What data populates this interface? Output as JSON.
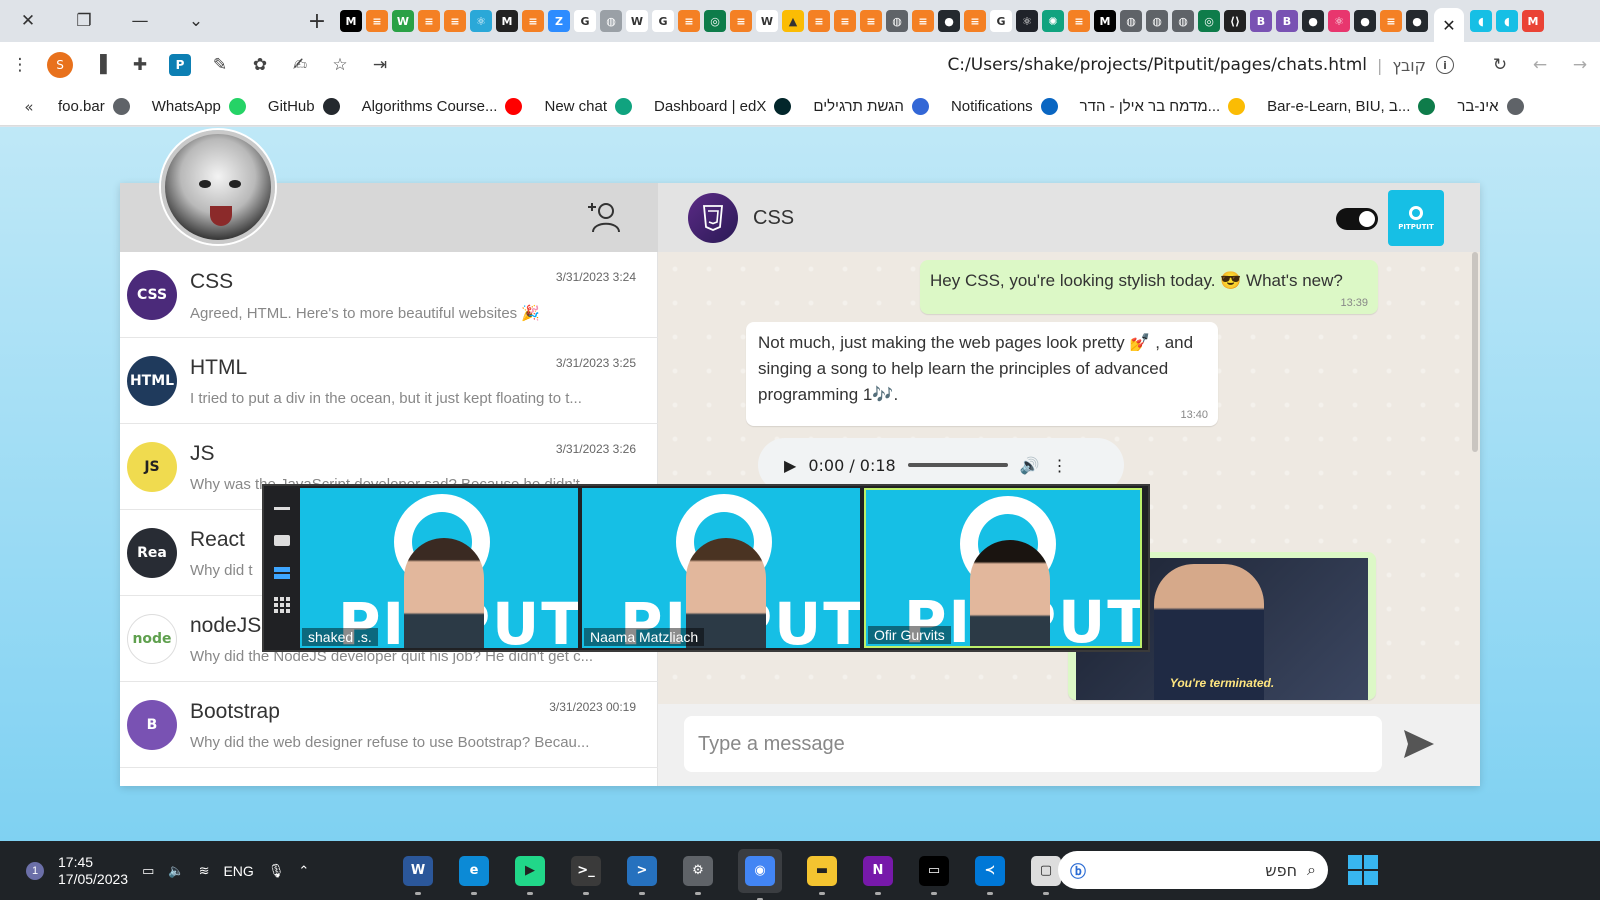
{
  "browser": {
    "window_controls": [
      "✕",
      "❐",
      "—",
      "⌄"
    ],
    "favicon_tabs": [
      {
        "icon": "medium-icon",
        "color": "#000000",
        "glyph": "M"
      },
      {
        "icon": "stackoverflow-icon",
        "color": "#f48024",
        "glyph": "≡"
      },
      {
        "icon": "wix-icon",
        "color": "#2aa146",
        "glyph": "W"
      },
      {
        "icon": "stackoverflow-icon",
        "color": "#f48024",
        "glyph": "≡"
      },
      {
        "icon": "stackoverflow-icon",
        "color": "#f48024",
        "glyph": "≡"
      },
      {
        "icon": "react-icon",
        "color": "#2aa8d8",
        "glyph": "⚛"
      },
      {
        "icon": "medium-icon",
        "color": "#222222",
        "glyph": "M"
      },
      {
        "icon": "stackoverflow-icon",
        "color": "#f48024",
        "glyph": "≡"
      },
      {
        "icon": "zoom-icon",
        "color": "#2d8cff",
        "glyph": "Z"
      },
      {
        "icon": "google-icon",
        "color": "#ffffff",
        "glyph": "G"
      },
      {
        "icon": "globe-icon",
        "color": "#9aa0a6",
        "glyph": "◍"
      },
      {
        "icon": "wikipedia-icon",
        "color": "#ffffff",
        "glyph": "W"
      },
      {
        "icon": "google-icon",
        "color": "#ffffff",
        "glyph": "G"
      },
      {
        "icon": "stackoverflow-icon",
        "color": "#f48024",
        "glyph": "≡"
      },
      {
        "icon": "moodle-icon",
        "color": "#0e7c4a",
        "glyph": "◎"
      },
      {
        "icon": "stackoverflow-icon",
        "color": "#f48024",
        "glyph": "≡"
      },
      {
        "icon": "wikipedia-icon",
        "color": "#ffffff",
        "glyph": "W"
      },
      {
        "icon": "drive-icon",
        "color": "#fbbc04",
        "glyph": "▲"
      },
      {
        "icon": "stackoverflow-icon",
        "color": "#f48024",
        "glyph": "≡"
      },
      {
        "icon": "stackoverflow-icon",
        "color": "#f48024",
        "glyph": "≡"
      },
      {
        "icon": "stackoverflow-icon",
        "color": "#f48024",
        "glyph": "≡"
      },
      {
        "icon": "globe-icon",
        "color": "#5f6368",
        "glyph": "◍"
      },
      {
        "icon": "stackoverflow-icon",
        "color": "#f48024",
        "glyph": "≡"
      },
      {
        "icon": "github-icon",
        "color": "#24292e",
        "glyph": "●"
      },
      {
        "icon": "stackoverflow-icon",
        "color": "#f48024",
        "glyph": "≡"
      },
      {
        "icon": "google-icon",
        "color": "#ffffff",
        "glyph": "G"
      },
      {
        "icon": "react-icon",
        "color": "#20232a",
        "glyph": "⚛"
      },
      {
        "icon": "chatgpt-icon",
        "color": "#10a37f",
        "glyph": "✺"
      },
      {
        "icon": "stackoverflow-icon",
        "color": "#f48024",
        "glyph": "≡"
      },
      {
        "icon": "medium-icon",
        "color": "#000000",
        "glyph": "M"
      },
      {
        "icon": "globe-icon",
        "color": "#5f6368",
        "glyph": "◍"
      },
      {
        "icon": "globe-icon",
        "color": "#5f6368",
        "glyph": "◍"
      },
      {
        "icon": "globe-icon",
        "color": "#5f6368",
        "glyph": "◍"
      },
      {
        "icon": "moodle-icon",
        "color": "#0e7c4a",
        "glyph": "◎"
      },
      {
        "icon": "n8n-icon",
        "color": "#222222",
        "glyph": "⟨⟩"
      },
      {
        "icon": "bootstrap-icon",
        "color": "#7952b3",
        "glyph": "B"
      },
      {
        "icon": "bootstrap-icon",
        "color": "#7952b3",
        "glyph": "B"
      },
      {
        "icon": "github-icon",
        "color": "#24292e",
        "glyph": "●"
      },
      {
        "icon": "react-icon",
        "color": "#e8366e",
        "glyph": "⚛"
      },
      {
        "icon": "github-icon",
        "color": "#24292e",
        "glyph": "●"
      },
      {
        "icon": "stackoverflow-icon",
        "color": "#f48024",
        "glyph": "≡"
      },
      {
        "icon": "github-icon",
        "color": "#24292e",
        "glyph": "●"
      }
    ],
    "active_tab_close": "✕",
    "trailing_tabs": [
      {
        "icon": "chat-icon",
        "color": "#16bfe5",
        "glyph": "◖"
      },
      {
        "icon": "chat-icon",
        "color": "#16bfe5",
        "glyph": "◖"
      },
      {
        "icon": "gmail-icon",
        "color": "#ea4335",
        "glyph": "M"
      }
    ],
    "profile_letter": "S",
    "url": "C:/Users/shake/projects/Pitputit/pages/chats.html",
    "url_scheme_label": "קובץ",
    "bookmarks": [
      {
        "label": "foo.bar",
        "icon": "globe-icon",
        "color": "#5f6368"
      },
      {
        "label": "WhatsApp",
        "icon": "whatsapp-icon",
        "color": "#25d366"
      },
      {
        "label": "GitHub",
        "icon": "github-icon",
        "color": "#24292e"
      },
      {
        "label": "Algorithms Course...",
        "icon": "youtube-icon",
        "color": "#ff0000"
      },
      {
        "label": "New chat",
        "icon": "chatgpt-icon",
        "color": "#10a37f"
      },
      {
        "label": "Dashboard | edX",
        "icon": "edx-icon",
        "color": "#02262b"
      },
      {
        "label": "הגשת תרגילים",
        "icon": "submit-icon",
        "color": "#3367d6"
      },
      {
        "label": "Notifications",
        "icon": "linkedin-icon",
        "color": "#0a66c2"
      },
      {
        "label": "מדמח בר אילן - הדר...",
        "icon": "drive-icon",
        "color": "#fbbc04"
      },
      {
        "label": "Bar-e-Learn, BIU, ב...",
        "icon": "moodle-icon",
        "color": "#0e7c4a"
      },
      {
        "label": "אינ-בר",
        "icon": "globe-icon",
        "color": "#5f6368"
      }
    ]
  },
  "app": {
    "current_user_avatar": "user-avatar",
    "chats": [
      {
        "name": "CSS",
        "time": "3/31/2023 3:24",
        "preview": "Agreed, HTML. Here's to more beautiful websites 🎉",
        "avatar_color": "#4b2a7a",
        "avatar_text": "CSS"
      },
      {
        "name": "HTML",
        "time": "3/31/2023 3:25",
        "preview": "I tried to put a div in the ocean, but it just kept floating to t...",
        "avatar_color": "#1f3a5c",
        "avatar_text": "HTML"
      },
      {
        "name": "JS",
        "time": "3/31/2023 3:26",
        "preview": "Why was the JavaScript developer sad? Because he didn't",
        "avatar_color": "#f0db4f",
        "avatar_text": "JS"
      },
      {
        "name": "React",
        "time": "",
        "preview": "Why did t",
        "avatar_color": "#282c34",
        "avatar_text": "Rea"
      },
      {
        "name": "nodeJS",
        "time": "",
        "preview": "Why did the NodeJS developer quit his job? He didn't get c...",
        "avatar_color": "#ffffff",
        "avatar_text": "node"
      },
      {
        "name": "Bootstrap",
        "time": "3/31/2023 00:19",
        "preview": "Why did the web designer refuse to use Bootstrap? Becau...",
        "avatar_color": "#7952b3",
        "avatar_text": "B"
      }
    ],
    "active_chat": {
      "name": "CSS",
      "toggle_on": true,
      "brand": "PITPUTIT",
      "messages": [
        {
          "direction": "out",
          "text": "Hey CSS, you're looking stylish today. 😎 What's new?",
          "time": "13:39"
        },
        {
          "direction": "in",
          "text": "Not much, just making the web pages look pretty 💅 , and singing a song to help learn the principles of advanced programming 1🎶.",
          "time": "13:40"
        }
      ],
      "audio": {
        "time": "0:00 / 0:18"
      },
      "gif_caption": "You're terminated."
    },
    "composer": {
      "placeholder": "Type a message"
    }
  },
  "call": {
    "participants": [
      {
        "name": "shaked .s.",
        "selected": false,
        "hair": "#3a2a22"
      },
      {
        "name": "Naama Matzliach",
        "selected": false,
        "hair": "#4a3322"
      },
      {
        "name": "Ofir Gurvits",
        "selected": true,
        "hair": "#1a1410"
      }
    ],
    "tile_brand": "PITPUTIT",
    "colors": {
      "tile_bg": "#16bfe5",
      "selected_border": "#bdf06b"
    }
  },
  "taskbar": {
    "notification_count": "1",
    "time": "17:45",
    "date": "17/05/2023",
    "language": "ENG",
    "search_placeholder": "חפש",
    "apps": [
      {
        "icon": "word-icon",
        "color": "#2b579a",
        "glyph": "W"
      },
      {
        "icon": "edge-icon",
        "color": "#0c8ad6",
        "glyph": "e"
      },
      {
        "icon": "pycharm-icon",
        "color": "#21d789",
        "glyph": "▶"
      },
      {
        "icon": "terminal-icon",
        "color": "#3a3a3a",
        "glyph": ">_"
      },
      {
        "icon": "powershell-icon",
        "color": "#2671be",
        "glyph": ">"
      },
      {
        "icon": "settings-icon",
        "color": "#5f6368",
        "glyph": "⚙"
      },
      {
        "icon": "chrome-icon",
        "color": "#4285f4",
        "glyph": "◉"
      },
      {
        "icon": "file-explorer-icon",
        "color": "#f4c430",
        "glyph": "▬"
      },
      {
        "icon": "onenote-icon",
        "color": "#7719aa",
        "glyph": "N"
      },
      {
        "icon": "cmd-icon",
        "color": "#000000",
        "glyph": "▭"
      },
      {
        "icon": "vscode-icon",
        "color": "#0078d7",
        "glyph": "≺"
      },
      {
        "icon": "window-icon",
        "color": "#dddddd",
        "glyph": "▢"
      }
    ]
  }
}
